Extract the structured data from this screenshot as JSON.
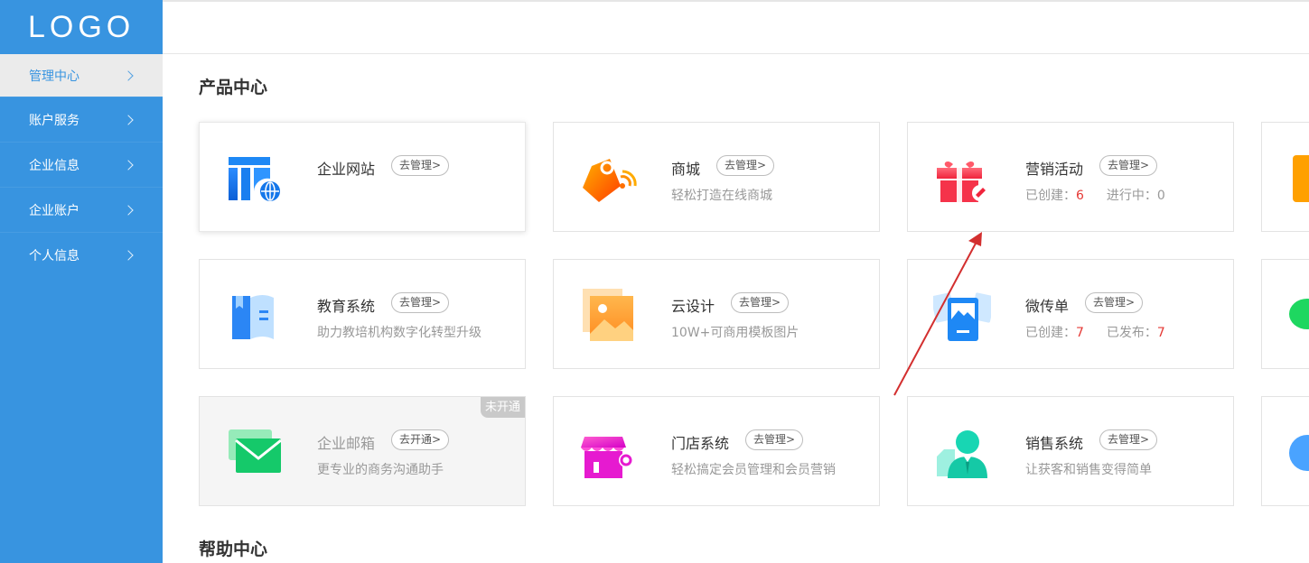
{
  "sidebar": {
    "logo": "LOGO",
    "items": [
      {
        "label": "管理中心"
      },
      {
        "label": "账户服务"
      },
      {
        "label": "企业信息"
      },
      {
        "label": "企业账户"
      },
      {
        "label": "个人信息"
      }
    ]
  },
  "sections": {
    "products_title": "产品中心",
    "help_title": "帮助中心"
  },
  "cards": [
    {
      "name": "企业网站",
      "action": "去管理>"
    },
    {
      "name": "商城",
      "action": "去管理>",
      "desc": "轻松打造在线商城"
    },
    {
      "name": "营销活动",
      "action": "去管理>",
      "stat1_label": "已创建：",
      "stat1_value": "6",
      "stat2_label": "进行中：",
      "stat2_value": "0"
    },
    {
      "name": "教育系统",
      "action": "去管理>",
      "desc": "助力教培机构数字化转型升级"
    },
    {
      "name": "云设计",
      "action": "去管理>",
      "desc": "10W+可商用模板图片"
    },
    {
      "name": "微传单",
      "action": "去管理>",
      "stat1_label": "已创建：",
      "stat1_value": "7",
      "stat2_label": "已发布：",
      "stat2_value": "7"
    },
    {
      "name": "企业邮箱",
      "action": "去开通>",
      "desc": "更专业的商务沟通助手",
      "badge": "未开通"
    },
    {
      "name": "门店系统",
      "action": "去管理>",
      "desc": "轻松搞定会员管理和会员营销"
    },
    {
      "name": "销售系统",
      "action": "去管理>",
      "desc": "让获客和销售变得简单"
    }
  ],
  "colors": {
    "sidebar": "#3894e0",
    "active_text": "#3894e0",
    "stat_number": "#e53935",
    "annotation_arrow": "#d32f2f"
  }
}
